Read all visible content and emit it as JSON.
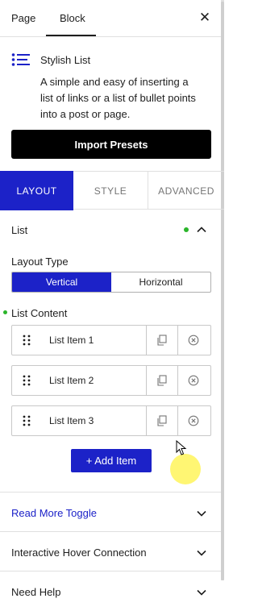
{
  "tabs": {
    "page": "Page",
    "block": "Block"
  },
  "block": {
    "icon": "list-icon",
    "title": "Stylish List",
    "description": "A simple and easy of inserting a list of links or a list of bullet points into a post or page.",
    "import_label": "Import Presets"
  },
  "sub_tabs": {
    "layout": "LAYOUT",
    "style": "STYLE",
    "advanced": "ADVANCED",
    "active": "LAYOUT"
  },
  "list_panel": {
    "title": "List",
    "layout_type_label": "Layout Type",
    "layout_options": [
      "Vertical",
      "Horizontal"
    ],
    "layout_selected": "Vertical",
    "list_content_label": "List Content",
    "items": [
      "List Item 1",
      "List Item 2",
      "List Item 3"
    ],
    "add_item_label": "+ Add Item"
  },
  "accordions": {
    "read_more": "Read More Toggle",
    "hover": "Interactive Hover Connection",
    "help": "Need Help"
  },
  "colors": {
    "accent": "#1c22c8",
    "indicator": "#2ab52a",
    "import_bg": "#000000"
  }
}
